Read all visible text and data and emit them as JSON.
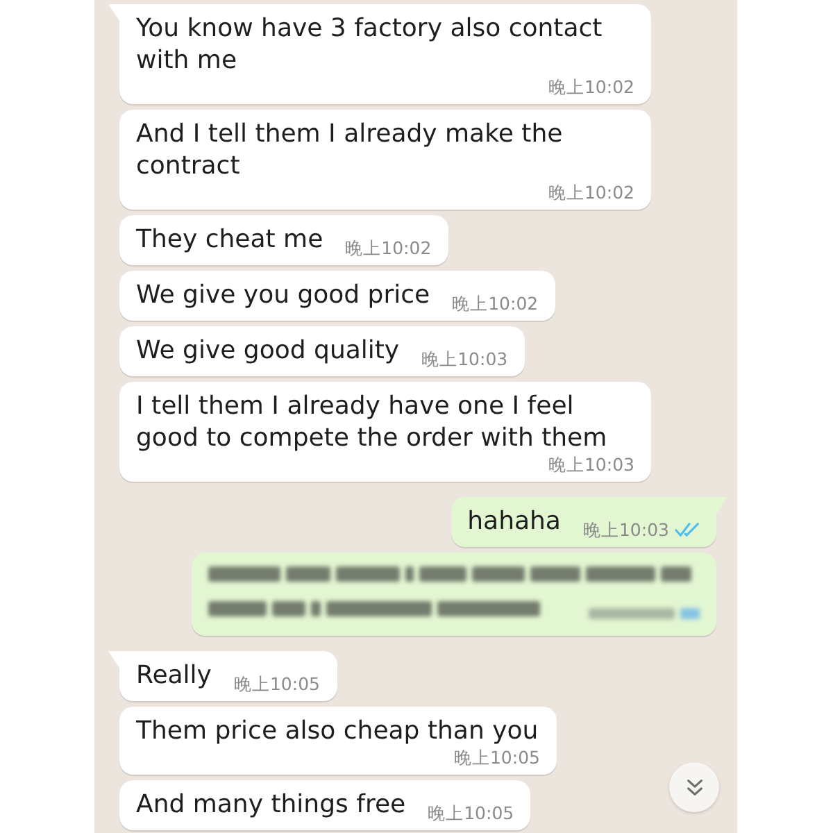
{
  "chat": {
    "messages": [
      {
        "kind": "text",
        "outgoing": false,
        "tail": true,
        "text": "You know have 3 factory also contact with me",
        "time": "晚上10:02"
      },
      {
        "kind": "text",
        "outgoing": false,
        "tail": false,
        "text": "And I tell them I already make the contract",
        "time": "晚上10:02"
      },
      {
        "kind": "text",
        "outgoing": false,
        "tail": false,
        "text": "They cheat me",
        "time": "晚上10:02"
      },
      {
        "kind": "text",
        "outgoing": false,
        "tail": false,
        "text": "We give you good price",
        "time": "晚上10:02"
      },
      {
        "kind": "text",
        "outgoing": false,
        "tail": false,
        "text": "We give good quality",
        "time": "晚上10:03"
      },
      {
        "kind": "text",
        "outgoing": false,
        "tail": false,
        "text": "I tell them I already have one I feel good to compete the order with them",
        "time": "晚上10:03"
      },
      {
        "kind": "text",
        "outgoing": true,
        "tail": true,
        "text": "hahaha",
        "time": "晚上10:03",
        "read": true
      },
      {
        "kind": "blurred",
        "outgoing": true,
        "tail": false
      },
      {
        "kind": "text",
        "outgoing": false,
        "tail": true,
        "text": "Really",
        "time": "晚上10:05"
      },
      {
        "kind": "text",
        "outgoing": false,
        "tail": false,
        "text": "Them price also cheap than you",
        "time": "晚上10:05"
      },
      {
        "kind": "text",
        "outgoing": false,
        "tail": false,
        "text": "And many things free",
        "time": "晚上10:05"
      }
    ]
  }
}
